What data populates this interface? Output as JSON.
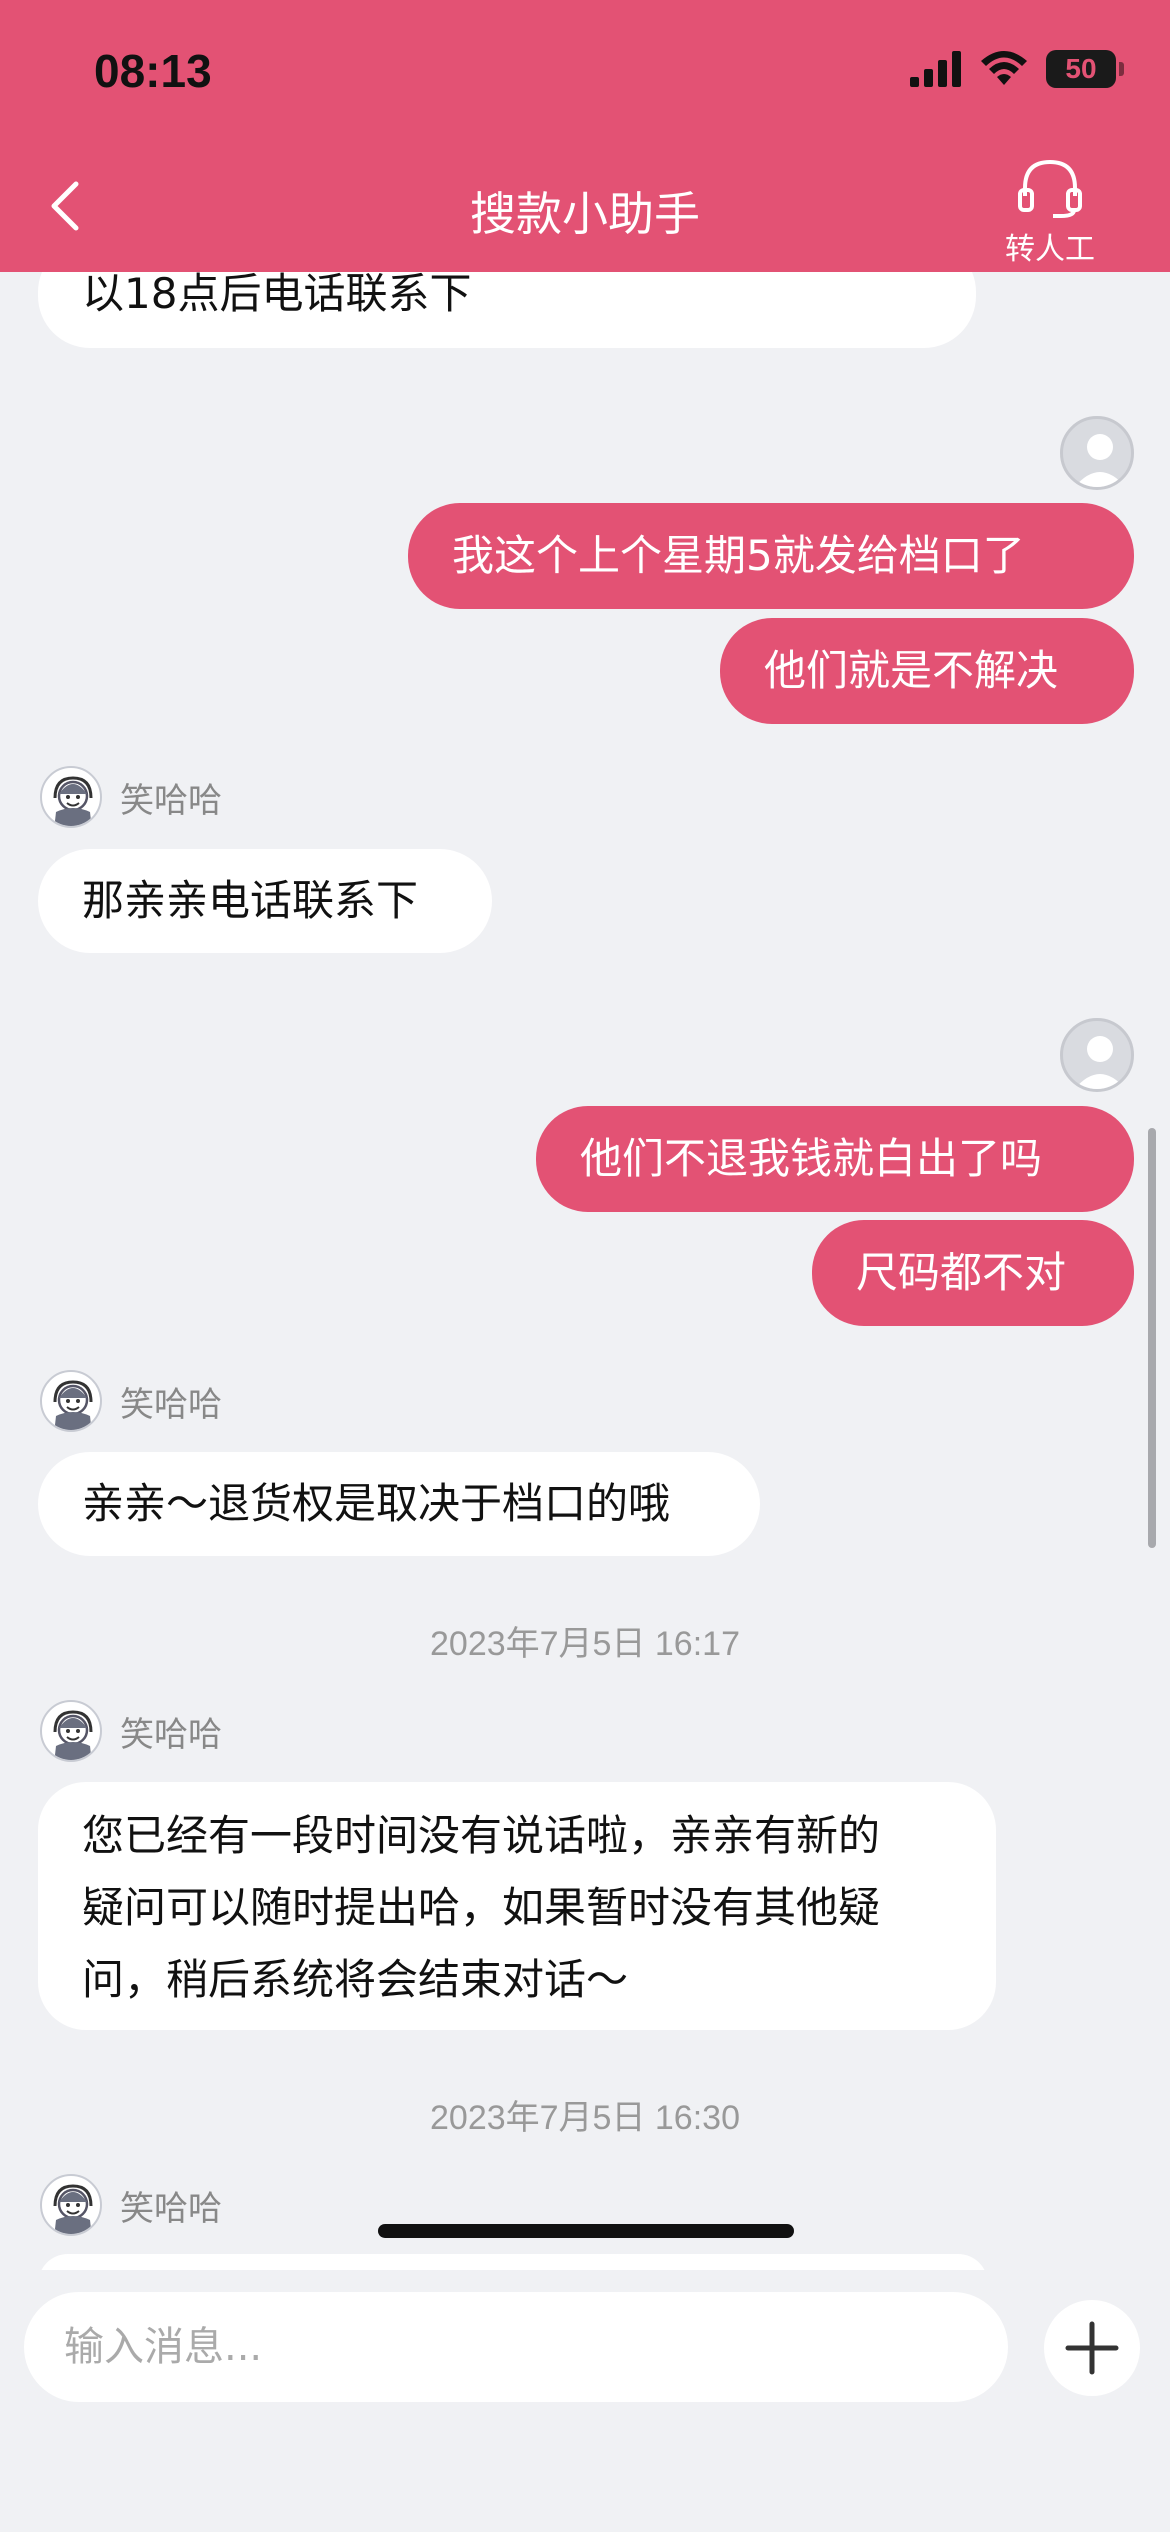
{
  "status_bar": {
    "time": "08:13",
    "battery": "50"
  },
  "header": {
    "title": "搜款小助手",
    "transfer_label": "转人工"
  },
  "agent_name": "笑哈哈",
  "messages": [
    {
      "side": "in",
      "text": "以18点后电话联系下"
    },
    {
      "side": "out",
      "text": "我这个上个星期5就发给档口了"
    },
    {
      "side": "out",
      "text": "他们就是不解决"
    },
    {
      "side": "in",
      "text": "那亲亲电话联系下"
    },
    {
      "side": "out",
      "text": "他们不退我钱就白出了吗"
    },
    {
      "side": "out",
      "text": "尺码都不对"
    },
    {
      "side": "in",
      "text": "亲亲～退货权是取决于档口的哦"
    },
    {
      "side": "in",
      "lines": [
        "您已经有一段时间没有说话啦，亲亲有新的",
        "疑问可以随时提出哈，如果暂时没有其他疑",
        "问，稍后系统将会结束对话～"
      ]
    }
  ],
  "timestamps": [
    "2023年7月5日 16:17",
    "2023年7月5日 16:30"
  ],
  "input": {
    "placeholder": "输入消息...",
    "value": ""
  },
  "colors": {
    "accent": "#e35274",
    "background": "#f0f1f4",
    "bubble_in": "#ffffff"
  },
  "icons": {
    "back": "chevron-left-icon",
    "transfer": "headset-icon",
    "plus": "plus-icon"
  }
}
